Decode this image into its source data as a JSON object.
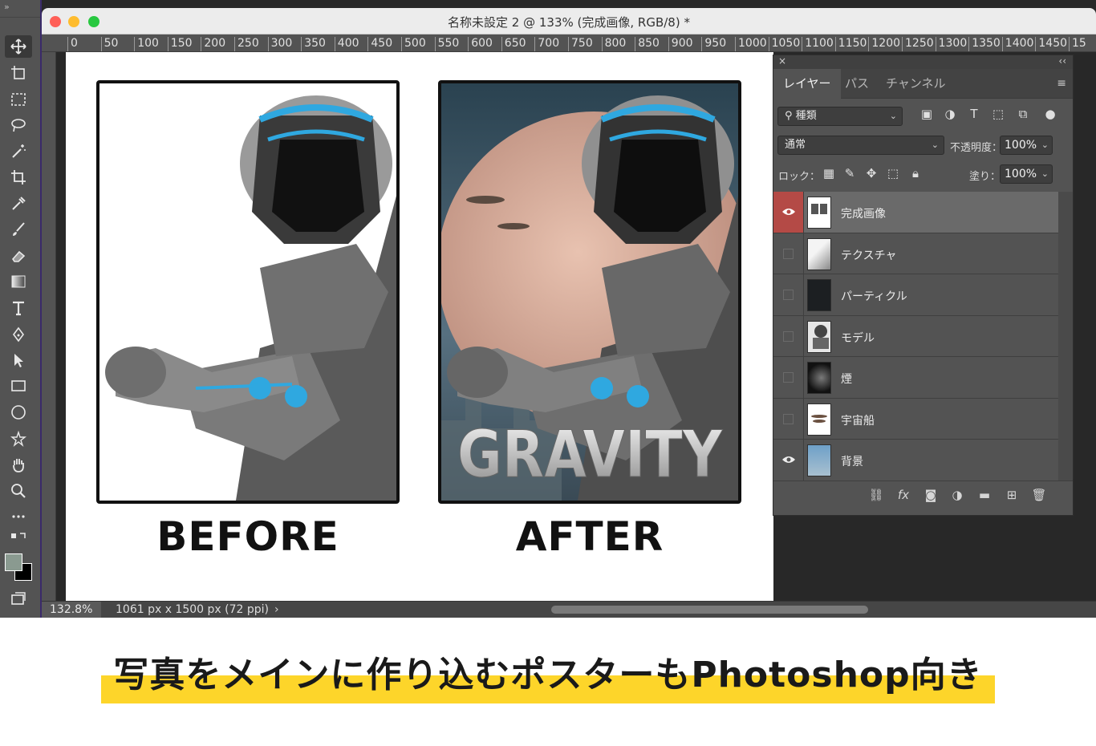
{
  "window": {
    "title": "名称未設定 2 @ 133% (完成画像, RGB/8) *",
    "traffic_colors": [
      "#ff5f57",
      "#febc2e",
      "#28c840"
    ]
  },
  "ruler": {
    "ticks": [
      "0",
      "50",
      "100",
      "150",
      "200",
      "250",
      "300",
      "350",
      "400",
      "450",
      "500",
      "550",
      "600",
      "650",
      "700",
      "750",
      "800",
      "850",
      "900",
      "950",
      "1000",
      "1050",
      "1100",
      "1150",
      "1200",
      "1250",
      "1300",
      "1350",
      "1400",
      "1450",
      "15"
    ]
  },
  "toolbar": {
    "grip": "»",
    "tools": [
      "move-tool",
      "artboard-tool",
      "marquee-tool",
      "lasso-tool",
      "magic-wand-tool",
      "crop-tool",
      "eyedropper-tool",
      "brush-tool",
      "eraser-tool",
      "gradient-tool",
      "type-tool",
      "pen-tool",
      "path-select-tool",
      "rectangle-tool",
      "ellipse-tool",
      "custom-shape-tool",
      "hand-tool",
      "zoom-tool",
      "more-tools"
    ],
    "fg_color": "#8a9a90",
    "bg_color": "#000000"
  },
  "document": {
    "before_label": "BEFORE",
    "after_label": "AFTER",
    "after_text": "GRAVITY"
  },
  "status": {
    "zoom": "132.8%",
    "info": "1061 px x 1500 px (72 ppi)",
    "arrow": "›"
  },
  "layers_panel": {
    "close": "×",
    "collapse": "‹‹",
    "tabs": [
      "レイヤー",
      "パス",
      "チャンネル"
    ],
    "filter_label": "種類",
    "blend_mode": "通常",
    "opacity_label": "不透明度：",
    "opacity_value": "100%",
    "lock_label": "ロック：",
    "fill_label": "塗り：",
    "fill_value": "100%",
    "layers": [
      {
        "name": "完成画像",
        "visible": true,
        "selected": true
      },
      {
        "name": "テクスチャ",
        "visible": false,
        "selected": false
      },
      {
        "name": "パーティクル",
        "visible": false,
        "selected": false
      },
      {
        "name": "モデル",
        "visible": false,
        "selected": false
      },
      {
        "name": "煙",
        "visible": false,
        "selected": false
      },
      {
        "name": "宇宙船",
        "visible": false,
        "selected": false
      },
      {
        "name": "背景",
        "visible": true,
        "selected": false
      }
    ]
  },
  "caption": "写真をメインに作り込むポスターもPhotoshop向き"
}
